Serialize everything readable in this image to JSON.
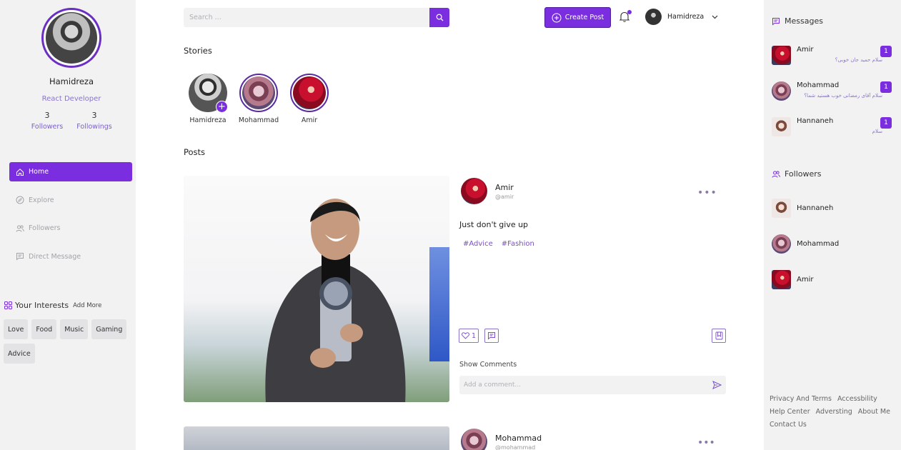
{
  "profile": {
    "name": "Hamidreza",
    "role": "React Developer",
    "followers_count": "3",
    "followers_label": "Followers",
    "followings_count": "3",
    "followings_label": "Followings"
  },
  "nav": [
    {
      "label": "Home",
      "icon": "home-icon",
      "active": true
    },
    {
      "label": "Explore",
      "icon": "compass-icon",
      "active": false
    },
    {
      "label": "Followers",
      "icon": "users-icon",
      "active": false
    },
    {
      "label": "Direct Message",
      "icon": "message-icon",
      "active": false
    }
  ],
  "interests": {
    "title": "Your Interests",
    "add_label": "Add More",
    "items": [
      "Love",
      "Food",
      "Music",
      "Gaming",
      "Advice"
    ]
  },
  "header": {
    "search_placeholder": "Search ...",
    "create_post_label": "Create Post",
    "user_name": "Hamidreza"
  },
  "stories": {
    "title": "Stories",
    "items": [
      {
        "name": "Hamidreza"
      },
      {
        "name": "Mohammad"
      },
      {
        "name": "Amir"
      }
    ]
  },
  "posts": {
    "title": "Posts",
    "items": [
      {
        "author": "Amir",
        "handle": "@amir",
        "caption": "Just don't give up",
        "tags": [
          "#Advice",
          "#Fashion"
        ],
        "likes": "1",
        "show_comments_label": "Show Comments",
        "comment_placeholder": "Add a comment..."
      },
      {
        "author": "Mohammad",
        "handle": "@mohammad"
      }
    ]
  },
  "messages": {
    "title": "Messages",
    "items": [
      {
        "name": "Amir",
        "preview": "سلام حمید جان خوبی؟",
        "unread": "1"
      },
      {
        "name": "Mohammad",
        "preview": "سلام آقای رمضانی خوب هستید شما؟",
        "unread": "1"
      },
      {
        "name": "Hannaneh",
        "preview": "سلام",
        "unread": "1"
      }
    ]
  },
  "followers": {
    "title": "Followers",
    "items": [
      {
        "name": "Hannaneh"
      },
      {
        "name": "Mohammad"
      },
      {
        "name": "Amir"
      }
    ]
  },
  "footer": {
    "links": [
      "Privacy And Terms",
      "Accessbility",
      "Help Center",
      "Adversting",
      "About Me",
      "Contact Us"
    ]
  },
  "colors": {
    "accent": "#7a2ee0",
    "sidebar_bg": "#f2f2f3",
    "muted_purple": "#8b74c9"
  }
}
